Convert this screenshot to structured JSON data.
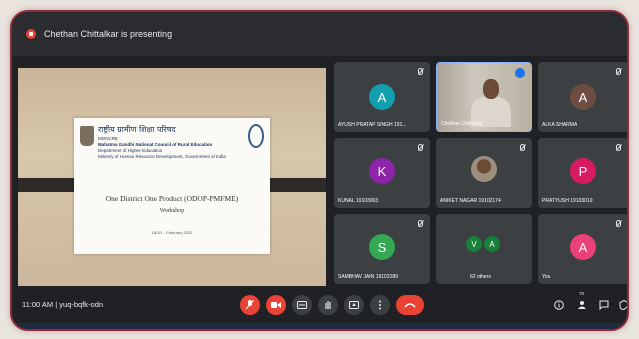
{
  "presenting_banner": "Chethan Chittalkar is presenting",
  "meeting": {
    "time": "11:00 AM",
    "separator": "|",
    "code": "yuq-bqfk-odn"
  },
  "slide": {
    "org_hindi": "राष्ट्रीय ग्रामीण शिक्षा परिषद",
    "org_name": "Mahatma Gandhi National Council of Rural Education",
    "dept": "Department of Higher Education",
    "ministry": "Ministry of Human Resource Development, Government of India",
    "logo_text": "MGNCRE",
    "title": "One District One Product (ODOP-PMFME)",
    "subtitle": "Workshop",
    "date": "18/1/1 - February 2022"
  },
  "participants": [
    {
      "name": "AYUSH PRATAP SINGH 191...",
      "initial": "A",
      "color": "#129eaf",
      "muted": true
    },
    {
      "name": "Chethan Chittalkar",
      "initial": "",
      "color": "",
      "muted": false,
      "speaking": true,
      "video": true
    },
    {
      "name": "ALKA SHARMA",
      "initial": "A",
      "color": "#6d4c41",
      "muted": true
    },
    {
      "name": "KUNAL 19103003",
      "initial": "K",
      "color": "#8e24aa",
      "muted": true
    },
    {
      "name": "ANIKET NAGAR 19102174",
      "initial": "",
      "color": "",
      "muted": true,
      "photo": true
    },
    {
      "name": "PRATYUSH 19103019",
      "initial": "P",
      "color": "#d81b60",
      "muted": true
    },
    {
      "name": "SAMBHAV JAIN 19103189",
      "initial": "S",
      "color": "#34a853",
      "muted": true
    },
    {
      "name": "62 others",
      "initial": "",
      "color": "#188038",
      "muted": false,
      "group": [
        "V",
        "A"
      ]
    },
    {
      "name": "You",
      "initial": "A",
      "color": "#ec407a",
      "muted": true
    }
  ],
  "controls": {
    "people_count": "70"
  },
  "icons": {
    "mic": "mic-off-icon",
    "cam": "camera-off-icon",
    "captions": "captions-icon",
    "hand": "raise-hand-icon",
    "present": "present-icon",
    "more": "more-icon",
    "hangup": "hangup-icon",
    "info": "info-icon",
    "people": "people-icon",
    "chat": "chat-icon",
    "activities": "activities-icon"
  }
}
